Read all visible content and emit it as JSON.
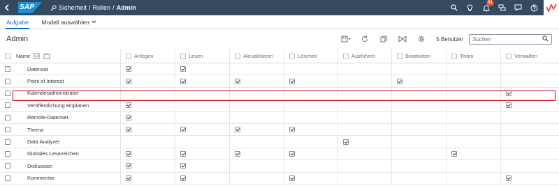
{
  "shell": {
    "logo": "SAP",
    "breadcrumb": [
      "Sicherheit",
      "Rollen",
      "Admin"
    ],
    "breadcrumb_sep": "/",
    "notification_count": "51",
    "colors": {
      "shell_bg": "#354a5f",
      "accent": "#0a6ed1",
      "badge": "#e64a3c",
      "highlight": "#d0021b"
    }
  },
  "tabs": [
    {
      "label": "Aufgabe",
      "active": true
    },
    {
      "label": "Modell auswählen",
      "active": false
    }
  ],
  "toolbar": {
    "title": "Admin",
    "users_count": "5 Benutzer",
    "search_placeholder": "Suchen"
  },
  "table": {
    "name_header": "Name",
    "columns": [
      "Anlegen",
      "Lesen",
      "Aktualisieren",
      "Löschen",
      "Ausführen",
      "Bearbeiten",
      "Teilen",
      "Verwalten"
    ],
    "rows": [
      {
        "name": "Datenset",
        "checks": [
          true,
          true,
          false,
          false,
          false,
          false,
          false,
          false
        ]
      },
      {
        "name": "Point of Interest",
        "checks": [
          true,
          true,
          true,
          true,
          false,
          true,
          false,
          false
        ]
      },
      {
        "name": "Kalenderadministrator",
        "checks": [
          false,
          false,
          false,
          false,
          false,
          false,
          false,
          true
        ],
        "highlighted": true
      },
      {
        "name": "Veröffentlichung einplanen",
        "checks": [
          true,
          false,
          false,
          false,
          false,
          false,
          false,
          true
        ]
      },
      {
        "name": "Remote-Datenset",
        "checks": [
          true,
          false,
          false,
          false,
          false,
          false,
          false,
          false
        ]
      },
      {
        "name": "Thema",
        "checks": [
          true,
          true,
          true,
          true,
          false,
          false,
          false,
          false
        ]
      },
      {
        "name": "Data Analyzer",
        "checks": [
          false,
          false,
          false,
          false,
          true,
          false,
          false,
          false
        ]
      },
      {
        "name": "Globales Lesezeichen",
        "checks": [
          true,
          true,
          true,
          true,
          false,
          false,
          true,
          false
        ]
      },
      {
        "name": "Diskussion",
        "checks": [
          true,
          true,
          false,
          false,
          false,
          false,
          false,
          false
        ]
      },
      {
        "name": "Kommentar",
        "checks": [
          true,
          true,
          false,
          true,
          false,
          false,
          false,
          true
        ]
      }
    ]
  }
}
